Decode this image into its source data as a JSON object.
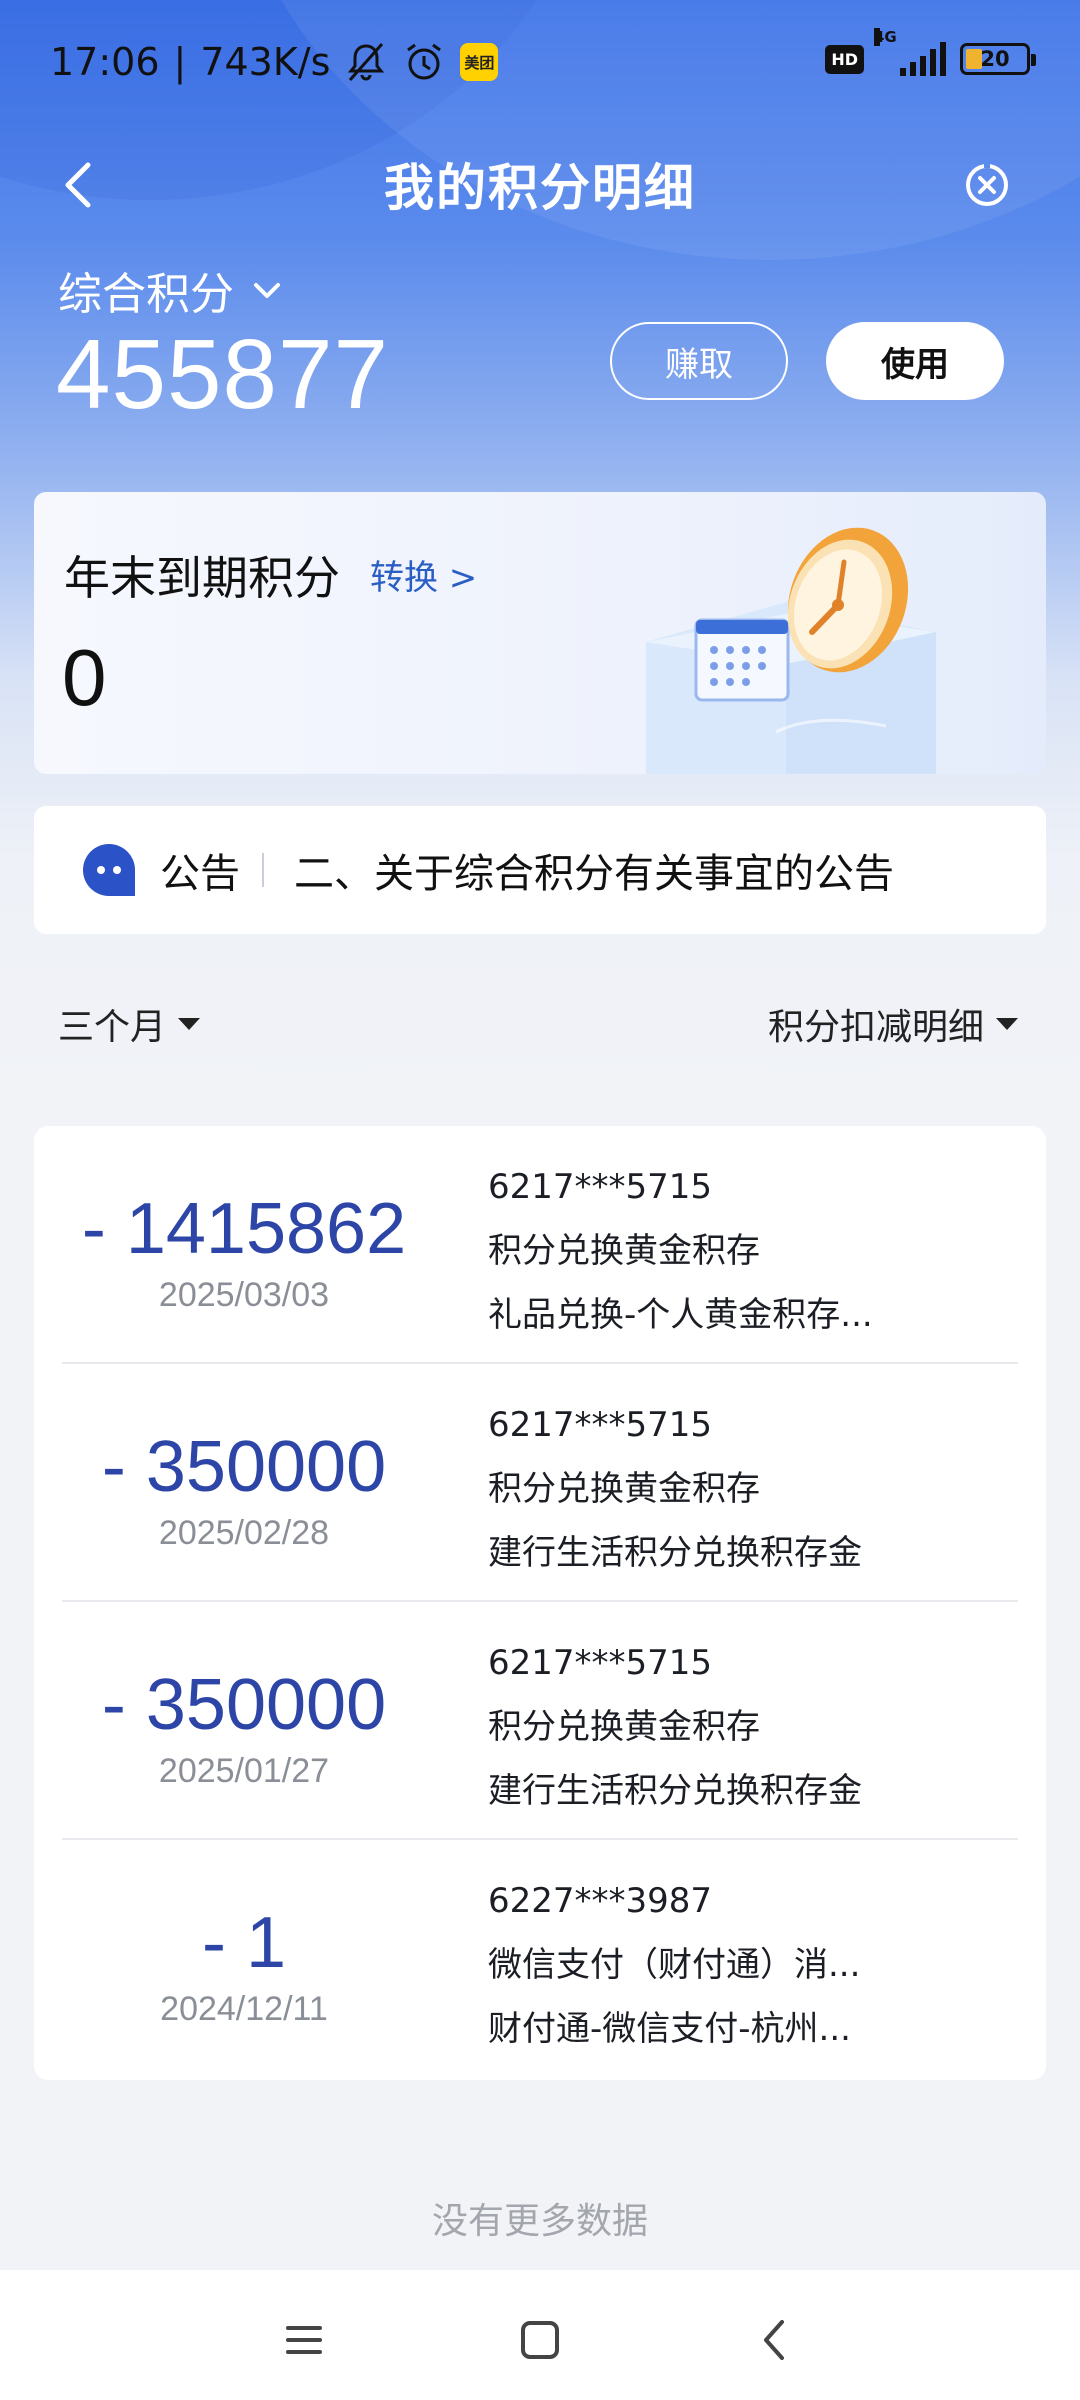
{
  "status_bar": {
    "time": "17:06",
    "speed": "743K/s",
    "meituan_label": "美团",
    "network": "4G",
    "battery": "20"
  },
  "header": {
    "title": "我的积分明细"
  },
  "points": {
    "type_label": "综合积分",
    "value": "455877",
    "earn_label": "赚取",
    "use_label": "使用"
  },
  "expire_card": {
    "title": "年末到期积分",
    "convert_label": "转换 >",
    "value": "0"
  },
  "notice": {
    "label": "公告",
    "text": "二、关于综合积分有关事宜的公告"
  },
  "filters": {
    "period": "三个月",
    "type": "积分扣减明细"
  },
  "records": [
    {
      "amount": "- 1415862",
      "date": "2025/03/03",
      "card": "6217***5715",
      "desc": "积分兑换黄金积存",
      "detail": "礼品兑换-个人黄金积存..."
    },
    {
      "amount": "- 350000",
      "date": "2025/02/28",
      "card": "6217***5715",
      "desc": "积分兑换黄金积存",
      "detail": "建行生活积分兑换积存金"
    },
    {
      "amount": "- 350000",
      "date": "2025/01/27",
      "card": "6217***5715",
      "desc": "积分兑换黄金积存",
      "detail": "建行生活积分兑换积存金"
    },
    {
      "amount": "- 1",
      "date": "2024/12/11",
      "card": "6227***3987",
      "desc": "微信支付（财付通）消...",
      "detail": "财付通-微信支付-杭州..."
    }
  ],
  "footer": {
    "no_more": "没有更多数据"
  },
  "colors": {
    "primary_blue": "#3d73e8",
    "amount_blue": "#2c45a6",
    "link_blue": "#2a5ec4"
  }
}
